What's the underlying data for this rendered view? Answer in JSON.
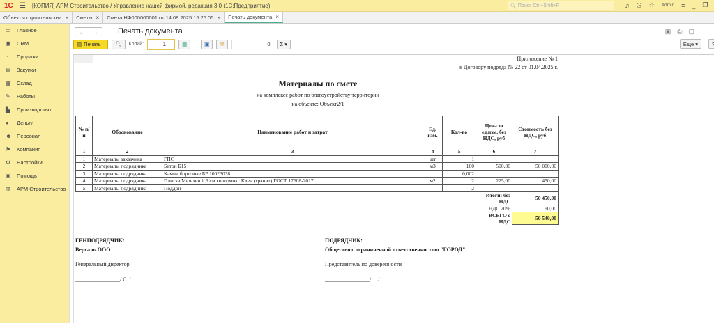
{
  "app": {
    "title": "[КОПИЯ] АРМ Строительство / Управление нашей фирмой, редакция 3.0  (1С:Предприятие)",
    "search_placeholder": "Поиск Ctrl+Shift+F",
    "user": "Admin"
  },
  "tabs": [
    {
      "label": "Объекты строительства"
    },
    {
      "label": "Сметы"
    },
    {
      "label": "Смета НФ000000001 от 14.08.2025 15:26:05"
    },
    {
      "label": "Печать документа",
      "active": true
    }
  ],
  "sidebar": {
    "items": [
      {
        "label": "Главное",
        "icon": "menu-icon"
      },
      {
        "label": "CRM",
        "icon": "crm-icon"
      },
      {
        "label": "Продажи",
        "icon": "sales-icon"
      },
      {
        "label": "Закупки",
        "icon": "cart-icon"
      },
      {
        "label": "Склад",
        "icon": "warehouse-icon"
      },
      {
        "label": "Работы",
        "icon": "wrench-icon"
      },
      {
        "label": "Производство",
        "icon": "factory-icon"
      },
      {
        "label": "Деньги",
        "icon": "money-icon"
      },
      {
        "label": "Персонал",
        "icon": "person-icon"
      },
      {
        "label": "Компания",
        "icon": "flag-icon"
      },
      {
        "label": "Настройки",
        "icon": "gear-icon"
      },
      {
        "label": "Помощь",
        "icon": "help-icon"
      },
      {
        "label": "АРМ Строительство",
        "icon": "building-icon"
      }
    ]
  },
  "form": {
    "title": "Печать документа",
    "print_label": "Печать",
    "copies_label": "Копий:",
    "copies_value": "1",
    "sum_value": "0",
    "more_label": "Еще",
    "help_label": "?"
  },
  "doc": {
    "appendix": "Приложение № 1",
    "contract": "к Договору подряда № 22 от  01.04.2025 г.",
    "title": "Материалы по смете",
    "subtitle": "на комплексе работ по благоустройству территории",
    "object": "на объекте: Объект2/1",
    "headers": [
      "№ п/п",
      "Обоснование",
      "Наименование работ и затрат",
      "Ед. изм.",
      "Кол-во",
      "Цена за ед.изм. без НДС, руб",
      "Стоимость без НДС, руб"
    ],
    "col_numbers": [
      "1",
      "2",
      "3",
      "4",
      "5",
      "6",
      "7"
    ],
    "rows": [
      [
        "1",
        "Материалы заказчика",
        "ГПС",
        "шт",
        "1",
        "",
        ""
      ],
      [
        "2",
        "Материалы подрядчика",
        "Бетон Б15",
        "м3",
        "100",
        "500,00",
        "50 000,00"
      ],
      [
        "3",
        "Материалы подрядчика",
        "Камни бортовые БР 100*30*8",
        "",
        "0,002",
        "",
        ""
      ],
      [
        "4",
        "Материалы подрядчика",
        "Плитка Мюнхен h 6 см колормикс Клен (гранит) ГОСТ 17608-2017",
        "м2",
        "2",
        "225,00",
        "450,00"
      ],
      [
        "5",
        "Материалы подрядчика",
        "Поддон",
        "",
        "2",
        "",
        ""
      ]
    ],
    "totals": [
      {
        "label": "Итоги: без НДС",
        "value": "50 450,00"
      },
      {
        "label": "НДС 20%",
        "value": "90,00"
      },
      {
        "label": "ВСЕГО с НДС",
        "value": "50 540,00"
      }
    ],
    "left_party": {
      "role": "ГЕНПОДРЯДЧИК:",
      "name": "Версаль ООО",
      "position": "Генеральный директор",
      "sign": "________________/ С              ./"
    },
    "right_party": {
      "role": "ПОДРЯДЧИК:",
      "name": "Общество с ограниченной ответственностью \"ГОРОД\"",
      "position": "Представитель по доверенности",
      "sign": "________________/ .              . /"
    }
  },
  "colors": {
    "accent": "#fbeda0",
    "print_button": "#f5d924",
    "total_highlight": "#fdfb92"
  }
}
